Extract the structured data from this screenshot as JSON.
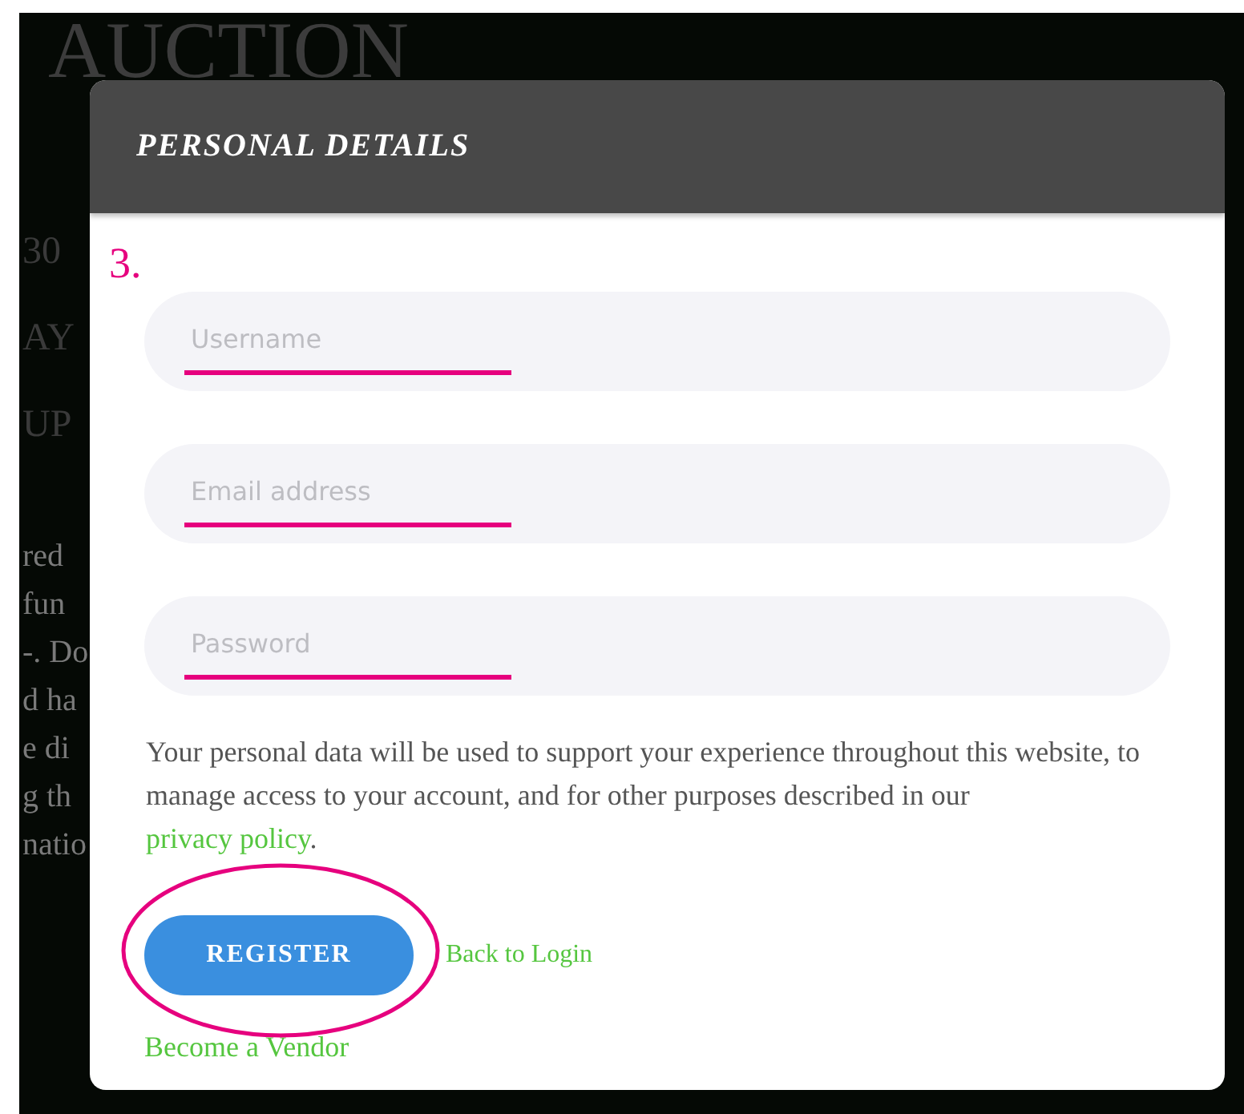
{
  "background": {
    "title": "AUCTION",
    "large_lines": [
      "30",
      "AY",
      "UP"
    ],
    "body_lines": [
      "red",
      "fun",
      "-. Do",
      "d ha",
      "e di",
      "g th",
      "natio"
    ]
  },
  "modal": {
    "title": "PERSONAL DETAILS",
    "annotation_label": "3.",
    "fields": [
      {
        "placeholder": "Username"
      },
      {
        "placeholder": "Email address"
      },
      {
        "placeholder": "Password"
      }
    ],
    "notice": "Your personal data will be used to support your experience throughout this website, to manage access to your account, and for other purposes described in our ",
    "notice_link": "privacy policy",
    "notice_end": ".",
    "register_button": "REGISTER",
    "back_link": "Back to Login",
    "vendor_link": "Become a Vendor"
  }
}
